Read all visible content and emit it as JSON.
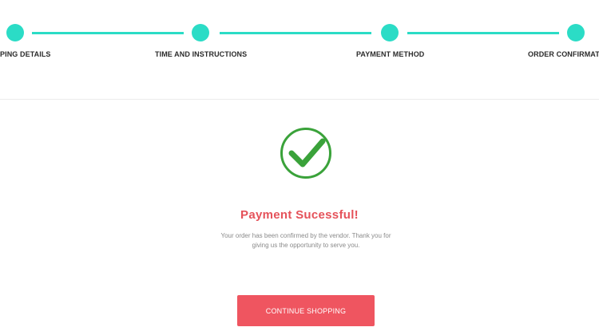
{
  "stepper": {
    "steps": [
      {
        "label": "PING DETAILS",
        "state": "complete"
      },
      {
        "label": "TIME AND INSTRUCTIONS",
        "state": "complete"
      },
      {
        "label": "PAYMENT METHOD",
        "state": "complete"
      },
      {
        "label": "ORDER CONFIRMATIO",
        "state": "complete"
      }
    ],
    "accent_color": "#2bdcc6"
  },
  "confirmation": {
    "icon": "check-circle-icon",
    "icon_color": "#3aa23a",
    "title": "Payment Sucessful!",
    "title_color": "#e5525a",
    "message": "Your order has been confirmed by the vendor. Thank you for giving us the opportunity to serve you.",
    "button_label": "CONTINUE SHOPPING",
    "button_color": "#ef5560"
  }
}
